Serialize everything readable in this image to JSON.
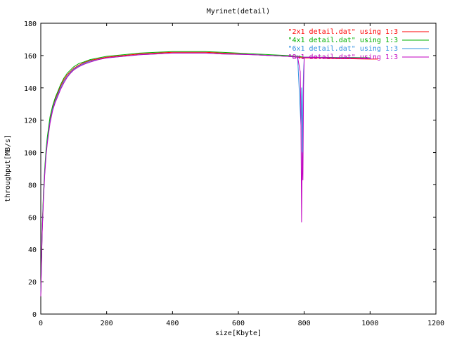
{
  "chart_data": {
    "type": "line",
    "title": "Myrinet(detail)",
    "xlabel": "size[Kbyte]",
    "ylabel": "throughput[MB/s]",
    "xlim": [
      0,
      1200
    ],
    "ylim": [
      0,
      180
    ],
    "x_ticks": [
      0,
      200,
      400,
      600,
      800,
      1000,
      1200
    ],
    "y_ticks": [
      0,
      20,
      40,
      60,
      80,
      100,
      120,
      140,
      160,
      180
    ],
    "grid": false,
    "legend_position": "top-right",
    "series": [
      {
        "name": "\"2x1 detail.dat\" using 1:3",
        "color": "#ff0000",
        "x": [
          0,
          4,
          8,
          12,
          16,
          20,
          28,
          36,
          44,
          52,
          60,
          70,
          80,
          90,
          100,
          115,
          130,
          150,
          175,
          200,
          250,
          300,
          350,
          400,
          450,
          500,
          550,
          600,
          650,
          700,
          750,
          780,
          800,
          850,
          900,
          950,
          1000,
          1024
        ],
        "values": [
          12,
          50,
          72,
          88,
          100,
          108,
          120,
          128,
          133,
          137,
          141,
          145,
          148,
          150,
          152,
          154,
          155.5,
          157,
          158,
          159,
          160,
          161,
          161.5,
          162,
          162,
          162,
          161.5,
          161,
          160.5,
          160,
          159.5,
          159,
          158.5,
          158.5,
          158,
          158,
          157.8,
          157.8
        ]
      },
      {
        "name": "\"4x1 detail.dat\" using 1:3",
        "color": "#00b000",
        "x": [
          0,
          4,
          8,
          12,
          16,
          20,
          28,
          36,
          44,
          52,
          60,
          70,
          80,
          90,
          100,
          115,
          130,
          150,
          175,
          200,
          250,
          300,
          350,
          400,
          450,
          500,
          550,
          600,
          650,
          700,
          750,
          780,
          800,
          850,
          900,
          950,
          1000
        ],
        "values": [
          13,
          52,
          74,
          90,
          102,
          110,
          122,
          129,
          134,
          138,
          142,
          146,
          149,
          151,
          153,
          155,
          156,
          157.5,
          158.5,
          159.5,
          160.5,
          161.5,
          162,
          162.5,
          162.5,
          162.5,
          162,
          161.5,
          161,
          160.5,
          160,
          159.5,
          159,
          159,
          158.8,
          158.8,
          158.6
        ]
      },
      {
        "name": "\"6x1 detail.dat\" using 1:3",
        "color": "#3090e0",
        "x": [
          0,
          4,
          8,
          12,
          16,
          20,
          28,
          36,
          44,
          52,
          60,
          70,
          80,
          90,
          100,
          115,
          130,
          150,
          175,
          200,
          250,
          300,
          350,
          400,
          450,
          500,
          550,
          600,
          650,
          700,
          750,
          780,
          790,
          792,
          794,
          796,
          798,
          800,
          850,
          900,
          950,
          1000
        ],
        "values": [
          12,
          50,
          71,
          87,
          99,
          107,
          119,
          127,
          132,
          136,
          140,
          144,
          147,
          149.5,
          151.5,
          153.5,
          155,
          156.5,
          157.5,
          158.5,
          159.5,
          160.5,
          161,
          161.5,
          161.5,
          161.5,
          161,
          160.8,
          160.5,
          160,
          159.5,
          159,
          117,
          140,
          92,
          135,
          150,
          159,
          158.8,
          158.6,
          158.5,
          158.4
        ]
      },
      {
        "name": "\"8x1 detail.dat\" using 1:3",
        "color": "#c000c0",
        "x": [
          0,
          4,
          8,
          12,
          16,
          20,
          28,
          36,
          44,
          52,
          60,
          70,
          80,
          90,
          100,
          115,
          130,
          150,
          175,
          200,
          250,
          300,
          350,
          400,
          450,
          500,
          550,
          600,
          650,
          700,
          750,
          780,
          788,
          790,
          792,
          794,
          796,
          798,
          800,
          850,
          900,
          950,
          1000
        ],
        "values": [
          11,
          49,
          70,
          86,
          98,
          106,
          118,
          126,
          131,
          135,
          139,
          143,
          146.5,
          149,
          151,
          153,
          154.5,
          156,
          157.5,
          158.5,
          159.5,
          160.5,
          161,
          161.5,
          161.5,
          161.5,
          161,
          160.8,
          160.5,
          160,
          159.5,
          159,
          150,
          120,
          57,
          100,
          83,
          140,
          159,
          158.8,
          158.6,
          158.5,
          158.4
        ]
      }
    ]
  }
}
